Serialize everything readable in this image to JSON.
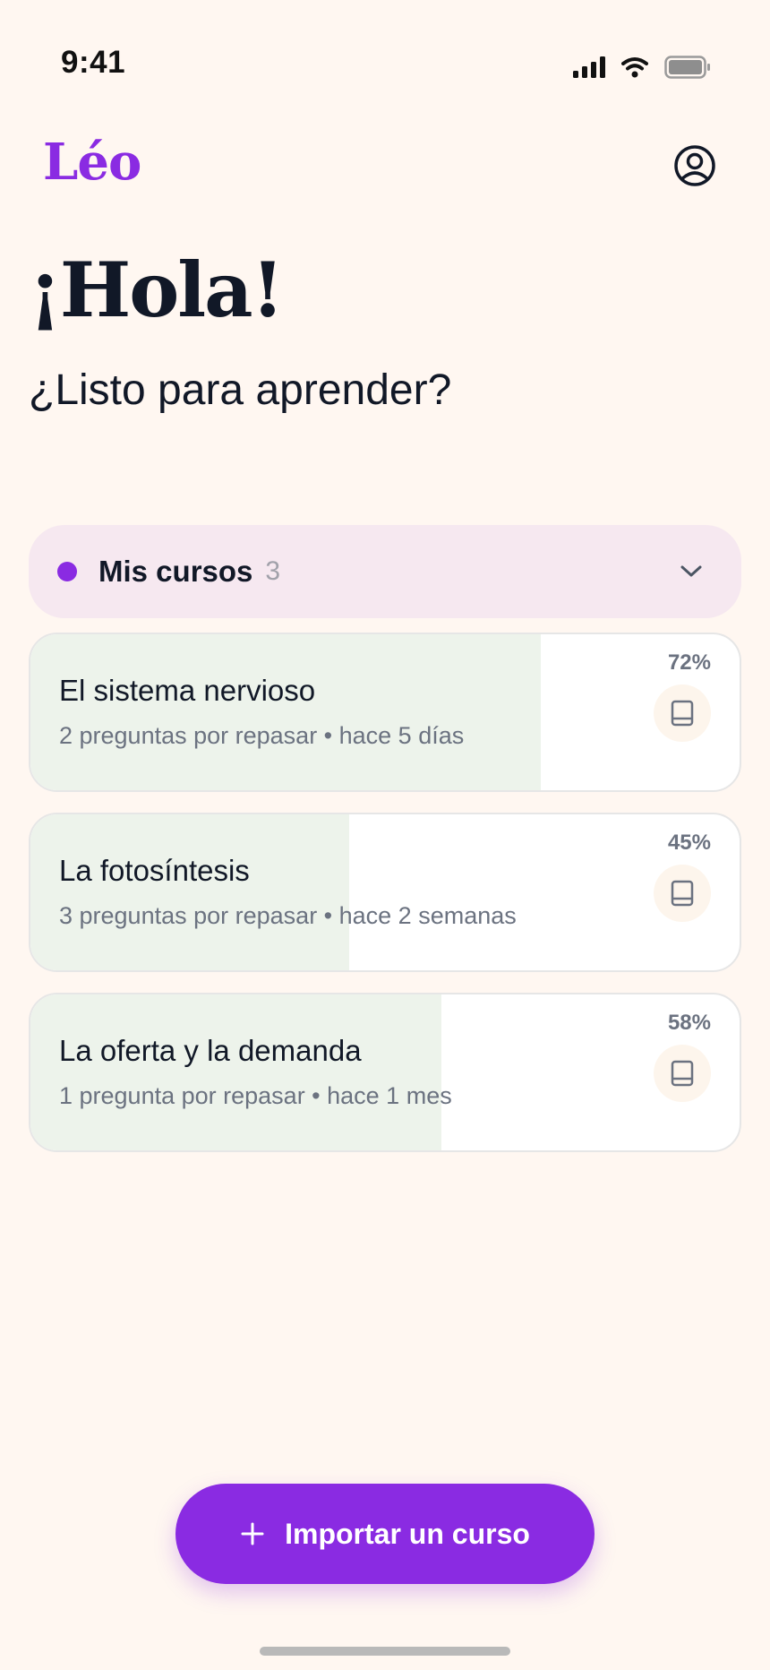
{
  "status_bar": {
    "time": "9:41",
    "icons": [
      "signal-icon",
      "wifi-icon",
      "battery-icon"
    ]
  },
  "header": {
    "logo": "Léo",
    "profile_icon": "user-circle-icon"
  },
  "greeting": {
    "title": "¡Hola!",
    "subtitle": "¿Listo para aprender?"
  },
  "courses_section": {
    "title": "Mis cursos",
    "count": "3",
    "chevron_icon": "chevron-down-icon"
  },
  "courses": [
    {
      "title": "El sistema nervioso",
      "meta": "2 preguntas por repasar • hace 5 días",
      "percent": "72%",
      "progress": 0.72
    },
    {
      "title": "La fotosíntesis",
      "meta": "3 preguntas por repasar • hace 2 semanas",
      "percent": "45%",
      "progress": 0.45
    },
    {
      "title": "La oferta y la demanda",
      "meta": "1 pregunta por repasar • hace 1 mes",
      "percent": "58%",
      "progress": 0.58
    }
  ],
  "import_button": {
    "label": "Importar un curso",
    "icon": "plus-icon"
  },
  "colors": {
    "background": "#FFF7F1",
    "accent": "#8A2BE2",
    "section_bg": "#F6E8F0",
    "progress_fill": "#EDF3EB",
    "text_primary": "#111827",
    "text_muted": "#6B7280"
  }
}
